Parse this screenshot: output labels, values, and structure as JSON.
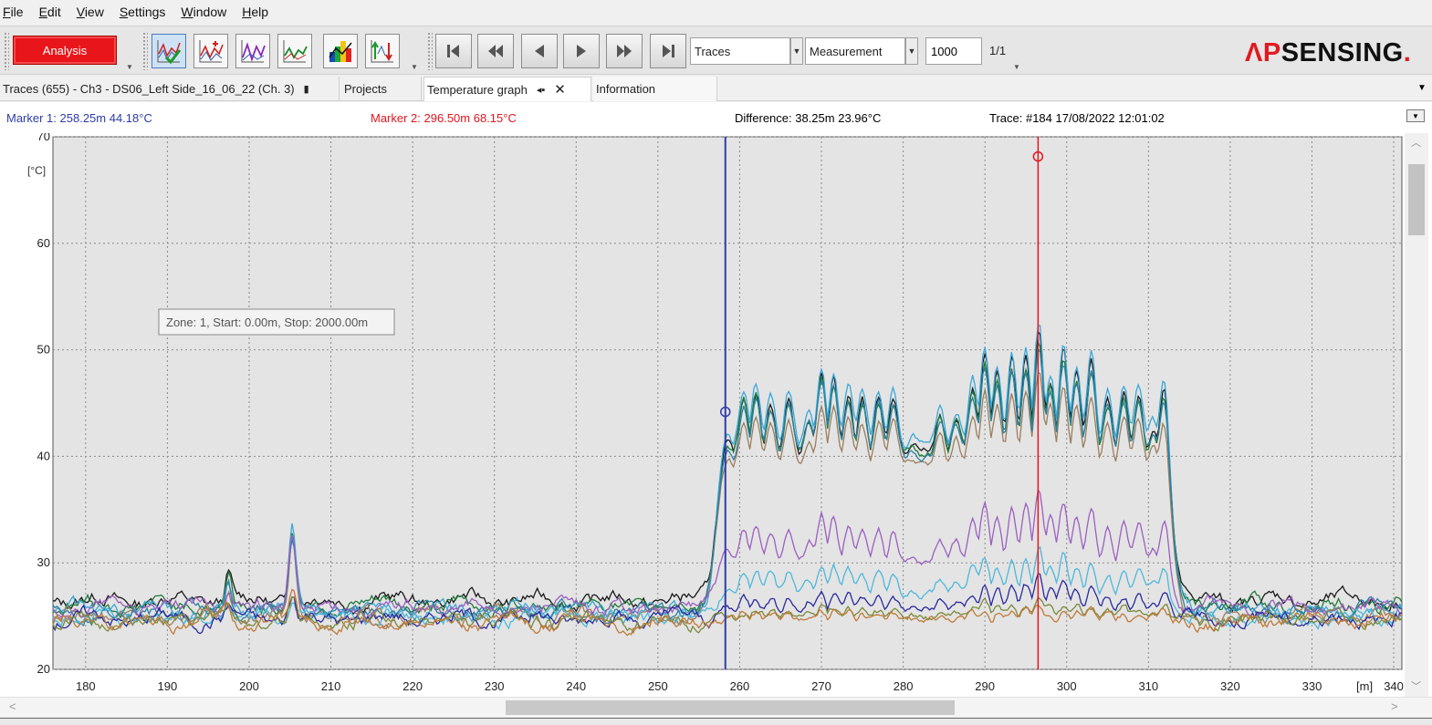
{
  "menu": [
    "File",
    "Edit",
    "View",
    "Settings",
    "Window",
    "Help"
  ],
  "toolbar": {
    "analysis_label": "Analysis",
    "tool_icons": [
      "trace-check-icon",
      "trace-red-icon",
      "trace-purple-icon",
      "trace-green-icon",
      "color-map-icon",
      "trace-compare-icon"
    ],
    "nav_icons": [
      "first-icon",
      "rewind-icon",
      "previous-icon",
      "next-icon",
      "fast-forward-icon",
      "last-icon"
    ],
    "trace_select": "Traces",
    "measurement_select": "Measurement",
    "count_value": "1000",
    "page": "1/1",
    "brand_ap": "ΛP",
    "brand_rest": "SENSING",
    "brand_dot": ".",
    "accent_color": "#e8161a"
  },
  "tabs": {
    "traces": "Traces (655) - Ch3 - DS06_Left Side_16_06_22 (Ch. 3)",
    "projects": "Projects",
    "temperature": "Temperature graph",
    "information": "Information"
  },
  "markers": {
    "marker1": "Marker 1:  258.25m 44.18°C",
    "marker2": "Marker 2:  296.50m 68.15°C",
    "difference": "Difference:  38.25m 23.96°C",
    "trace": "Trace:  #184 17/08/2022 12:01:02",
    "marker1_color": "#2e3ca8",
    "marker2_color": "#e0151e"
  },
  "chart_data": {
    "type": "line",
    "zone_tooltip": "Zone: 1, Start: 0.00m, Stop: 2000.00m",
    "x_unit_label": "[m]",
    "y_unit_label": "[°C]",
    "xlim": [
      176,
      341
    ],
    "ylim": [
      20,
      70
    ],
    "x_ticks": [
      180,
      190,
      200,
      210,
      220,
      230,
      240,
      250,
      260,
      270,
      280,
      290,
      300,
      310,
      320,
      330,
      340
    ],
    "y_ticks": [
      20,
      30,
      40,
      50,
      60,
      70
    ],
    "grid": true,
    "marker1_x": 258.25,
    "marker1_y": 44.18,
    "marker2_x": 296.5,
    "marker2_y": 68.15,
    "hot_zone": [
      257,
      313
    ],
    "series": [
      {
        "color": "#1a1a1a",
        "baseline": 26.5,
        "peak_level": 52,
        "dip_level": 40
      },
      {
        "color": "#1f7a3a",
        "baseline": 26.0,
        "peak_level": 51,
        "dip_level": 40
      },
      {
        "color": "#3aa7d8",
        "baseline": 25.5,
        "peak_level": 52.5,
        "dip_level": 41
      },
      {
        "color": "#9b7e5f",
        "baseline": 25.0,
        "peak_level": 48,
        "dip_level": 39
      },
      {
        "color": "#2b7fa0",
        "baseline": 25.5,
        "peak_level": 50.5,
        "dip_level": 40
      },
      {
        "color": "#9b5fc0",
        "baseline": 25.8,
        "peak_level": 37,
        "dip_level": 30
      },
      {
        "color": "#4cb8dc",
        "baseline": 25.0,
        "peak_level": 31.5,
        "dip_level": 27
      },
      {
        "color": "#2a2a9e",
        "baseline": 24.8,
        "peak_level": 28.5,
        "dip_level": 25.5
      },
      {
        "color": "#7a8a3a",
        "baseline": 24.5,
        "peak_level": 26.3,
        "dip_level": 24.8
      },
      {
        "color": "#c07a3a",
        "baseline": 24.5,
        "peak_level": 26,
        "dip_level": 24.5
      }
    ]
  }
}
